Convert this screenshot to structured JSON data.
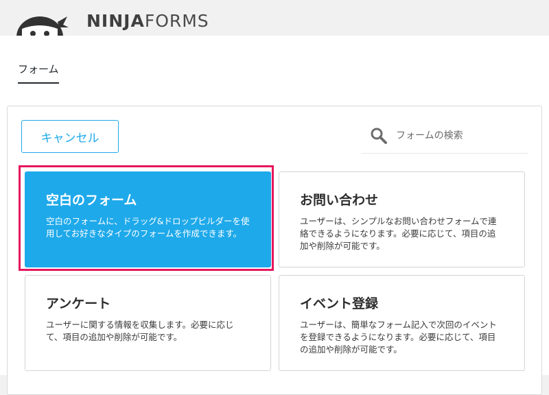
{
  "header": {
    "brand_bold": "NINJA",
    "brand_light": "FORMS"
  },
  "page_tab": {
    "label": "フォーム"
  },
  "toolbar": {
    "cancel_label": "キャンセル"
  },
  "search": {
    "placeholder": "フォームの検索",
    "icon": "search-icon"
  },
  "templates": [
    {
      "title": "空白のフォーム",
      "description": "空白のフォームに、ドラッグ&ドロップビルダーを使用してお好きなタイプのフォームを作成できます。",
      "selected": true
    },
    {
      "title": "お問い合わせ",
      "description": "ユーザーは、シンプルなお問い合わせフォームで連絡できるようになります。必要に応じて、項目の追加や削除が可能です。",
      "selected": false
    },
    {
      "title": "アンケート",
      "description": "ユーザーに関する情報を収集します。必要に応じて、項目の追加や削除が可能です。",
      "selected": false
    },
    {
      "title": "イベント登録",
      "description": "ユーザーは、簡単なフォーム記入で次回のイベントを登録できるようになります。必要に応じて、項目の追加や削除が可能です。",
      "selected": false
    }
  ],
  "colors": {
    "accent": "#1ea9ea",
    "highlight": "#e5175c",
    "text": "#2d2d2d"
  }
}
